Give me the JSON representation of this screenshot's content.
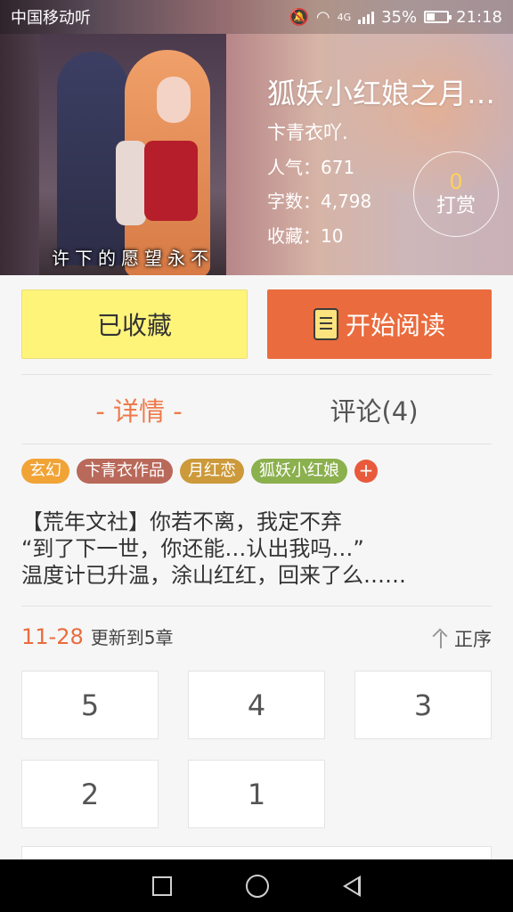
{
  "status_bar": {
    "carrier": "中国移动听",
    "network": "4G",
    "battery_percent": "35%",
    "battery_level": 0.35,
    "time": "21:18"
  },
  "book": {
    "title": "狐妖小红娘之月…",
    "author": "卞青衣吖.",
    "popularity": "人气：671",
    "word_count": "字数：4,798",
    "favorites": "收藏：10",
    "cover_caption": "许下的愿望永不"
  },
  "reward": {
    "count": "0",
    "label": "打赏"
  },
  "actions": {
    "favorited_label": "已收藏",
    "read_label": "开始阅读"
  },
  "tabs": {
    "detail": "- 详情 -",
    "comments": "评论(4)"
  },
  "tags": [
    {
      "label": "玄幻",
      "color": "#f1a336"
    },
    {
      "label": "卞青衣作品",
      "color": "#b9695a"
    },
    {
      "label": "月红恋",
      "color": "#cc9a3a"
    },
    {
      "label": "狐妖小红娘",
      "color": "#8bb04e"
    }
  ],
  "tag_more": "+",
  "description": [
    "【荒年文社】你若不离，我定不弃",
    "“到了下一世，你还能…认出我吗…”",
    "温度计已升温，涂山红红，回来了么……"
  ],
  "update": {
    "date": "11-28",
    "text": "更新到5章"
  },
  "sort_label": "正序",
  "chapters": [
    "5",
    "4",
    "3",
    "2",
    "1"
  ],
  "colors": {
    "accent": "#ea6b3d",
    "favorite_bg": "#fff47a"
  }
}
